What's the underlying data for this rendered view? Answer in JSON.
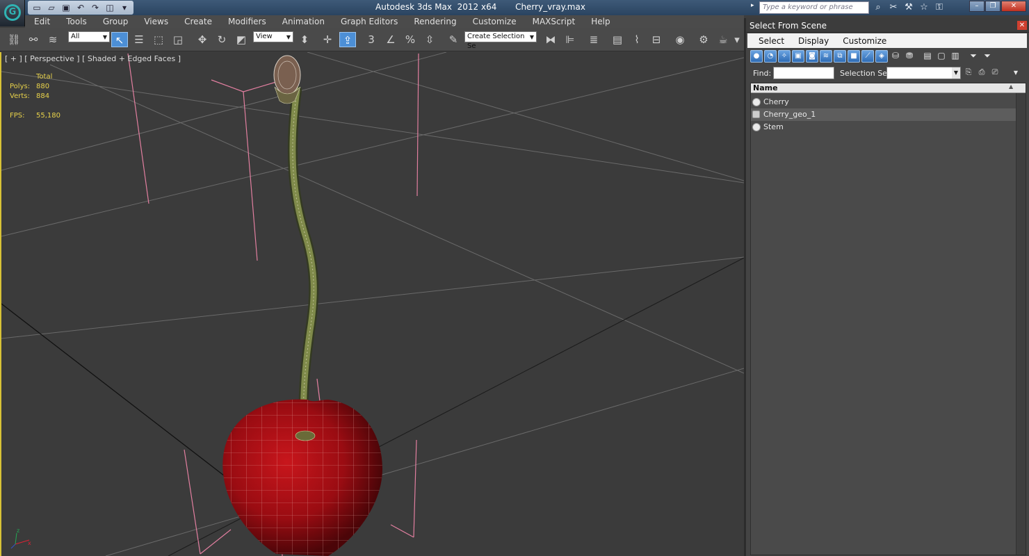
{
  "titlebar": {
    "app": "Autodesk 3ds Max  2012 x64",
    "file": "Cherry_vray.max",
    "search_placeholder": "Type a keyword or phrase",
    "qa_icons": [
      "new-icon",
      "open-icon",
      "save-icon",
      "undo-icon",
      "redo-icon",
      "project-icon",
      "window-icon"
    ],
    "help_icons": [
      "binoculars-icon",
      "tools-icon",
      "wrench-icon",
      "star-icon",
      "key-icon"
    ]
  },
  "menubar": {
    "items": [
      "Edit",
      "Tools",
      "Group",
      "Views",
      "Create",
      "Modifiers",
      "Animation",
      "Graph Editors",
      "Rendering",
      "Customize",
      "MAXScript",
      "Help"
    ]
  },
  "toolbar": {
    "filter_value": "All",
    "refcoord_value": "View",
    "selection_set_value": "Create Selection Se"
  },
  "viewport": {
    "label": "[ + ] [ Perspective ] [ Shaded + Edged Faces ]",
    "stats": {
      "total_label": "Total",
      "polys_label": "Polys:",
      "polys_value": "880",
      "verts_label": "Verts:",
      "verts_value": "884",
      "fps_label": "FPS:",
      "fps_value": "55,180"
    }
  },
  "select_from_scene": {
    "title": "Select From Scene",
    "menu": [
      "Select",
      "Display",
      "Customize"
    ],
    "find_label": "Find:",
    "selection_set_label": "Selection Set:",
    "column_name": "Name",
    "objects": [
      {
        "name": "Cherry",
        "selected": false
      },
      {
        "name": "Cherry_geo_1",
        "selected": true
      },
      {
        "name": "Stem",
        "selected": false
      }
    ]
  }
}
